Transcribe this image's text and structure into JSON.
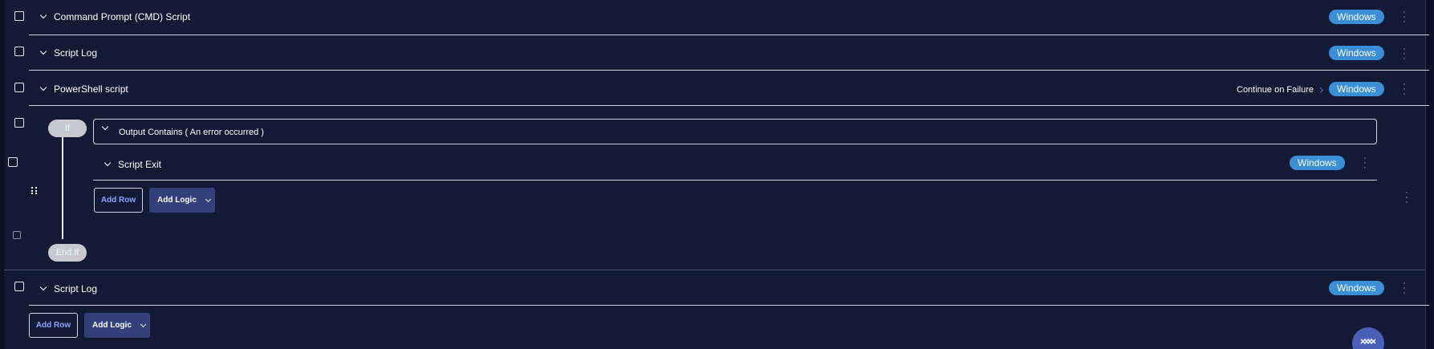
{
  "rows": [
    {
      "title": "Command Prompt (CMD) Script",
      "badge": "Windows"
    },
    {
      "title": "Script Log",
      "badge": "Windows"
    },
    {
      "title": "PowerShell script",
      "badge": "Windows",
      "action_label": "Continue on Failure"
    },
    {
      "title": "Script Log",
      "badge": "Windows"
    }
  ],
  "logic_block": {
    "if_label": "If",
    "end_label": "End If",
    "condition_text": "Output Contains ( An error occurred )",
    "nested_row": {
      "title": "Script Exit",
      "badge": "Windows"
    },
    "add_row_label": "Add Row",
    "add_logic_label": "Add Logic"
  },
  "footer": {
    "add_row_label": "Add Row",
    "add_logic_label": "Add Logic"
  },
  "colors": {
    "background": "#131a35",
    "badge": "#3a8fd6",
    "add_logic_bg": "#33407a",
    "add_row_text": "#8ea3ff"
  },
  "icons": {
    "fab": "support-chat-icon",
    "drag": "drag-handle-icon",
    "kebab": "more-options-icon"
  }
}
